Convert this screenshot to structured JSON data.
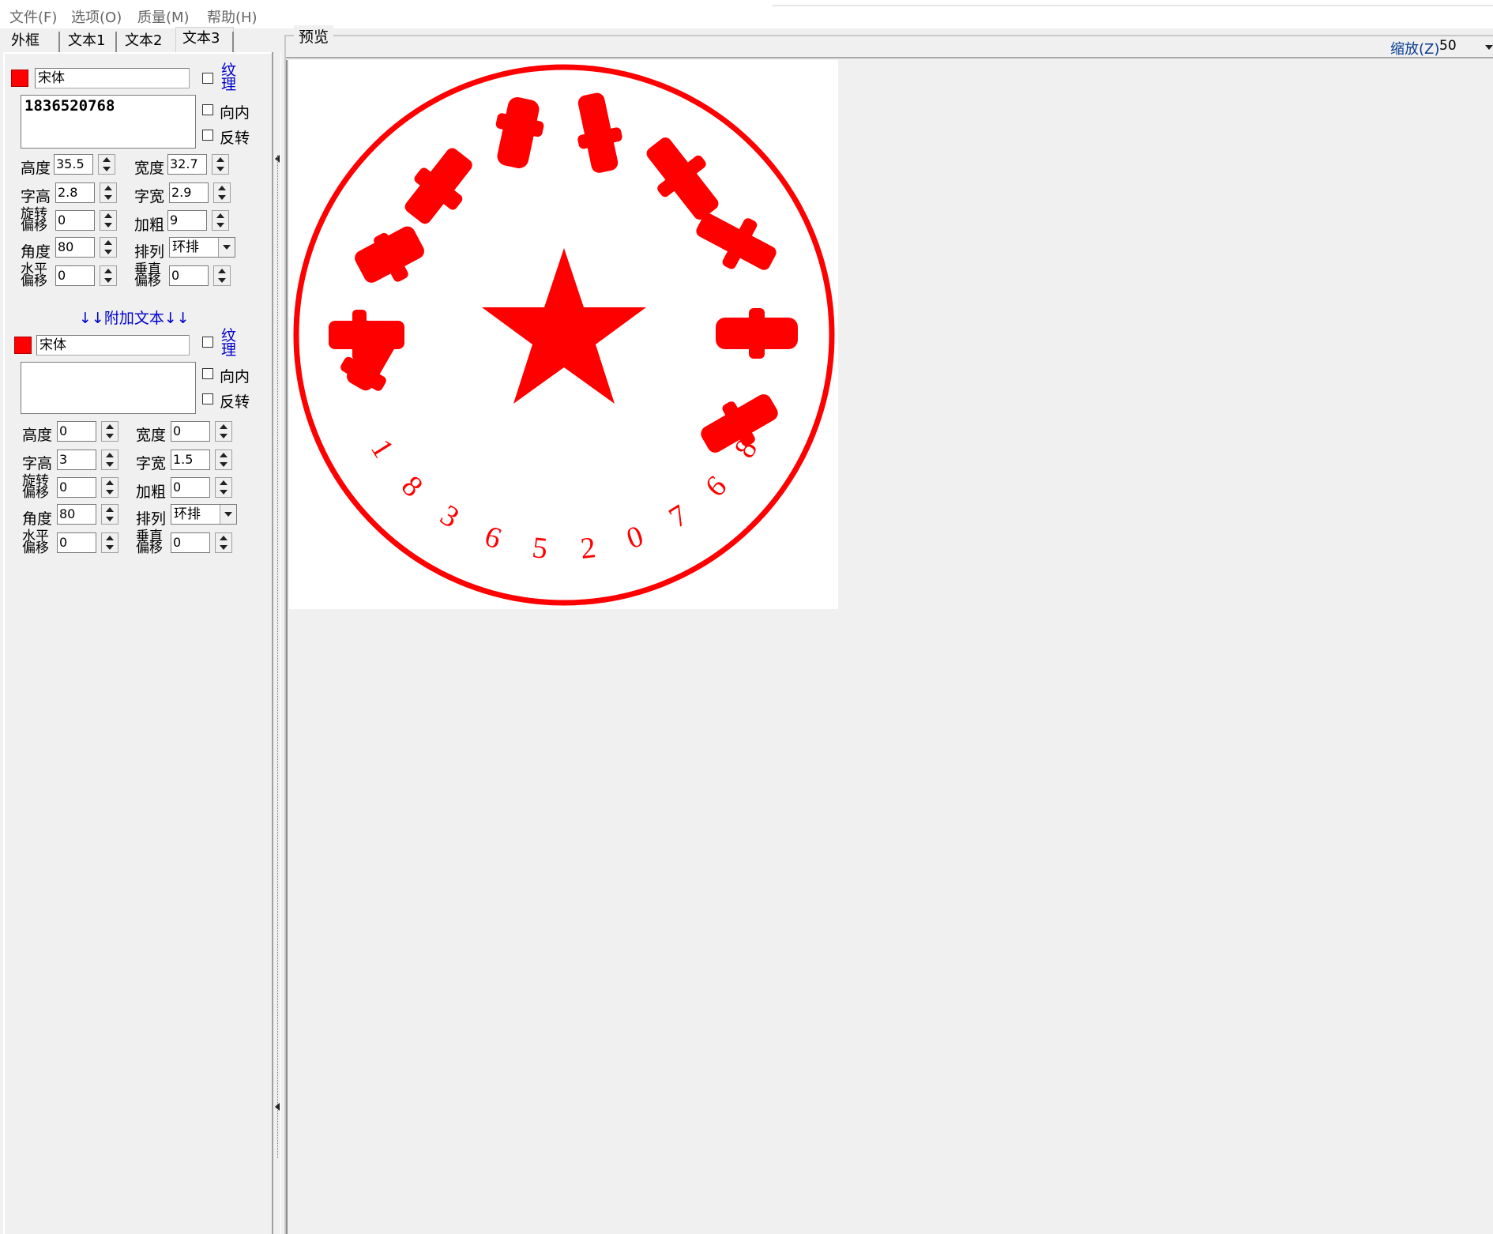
{
  "menu": {
    "file": "文件(F)",
    "options": "选项(O)",
    "quality": "质量(M)",
    "help": "帮助(H)"
  },
  "tabs": [
    "外框",
    "文本1",
    "文本2",
    "文本3"
  ],
  "active_tab": "文本3",
  "main_text": {
    "font": "宋体",
    "text": "1836520768",
    "texture_label_1": "纹",
    "texture_label_2": "理",
    "inward_label": "向内",
    "reverse_label": "反转",
    "height_label": "高度",
    "height": "35.5",
    "width_label": "宽度",
    "width": "32.7",
    "char_height_label": "字高",
    "char_height": "2.8",
    "char_width_label": "字宽",
    "char_width": "2.9",
    "rotate_offset_label_1": "旋转",
    "rotate_offset_label_2": "偏移",
    "rotate_offset": "0",
    "bold_label": "加粗",
    "bold": "9",
    "angle_label": "角度",
    "angle": "80",
    "arrange_label": "排列",
    "arrange": "环排",
    "h_offset_label_1": "水平",
    "h_offset_label_2": "偏移",
    "h_offset": "0",
    "v_offset_label_1": "垂直",
    "v_offset_label_2": "偏移",
    "v_offset": "0"
  },
  "extra_header": "↓↓附加文本↓↓",
  "extra_text": {
    "font": "宋体",
    "text": "",
    "texture_label_1": "纹",
    "texture_label_2": "理",
    "inward_label": "向内",
    "reverse_label": "反转",
    "height_label": "高度",
    "height": "0",
    "width_label": "宽度",
    "width": "0",
    "char_height_label": "字高",
    "char_height": "3",
    "char_width_label": "字宽",
    "char_width": "1.5",
    "rotate_offset_label_1": "旋转",
    "rotate_offset_label_2": "偏移",
    "rotate_offset": "0",
    "bold_label": "加粗",
    "bold": "0",
    "angle_label": "角度",
    "angle": "80",
    "arrange_label": "排列",
    "arrange": "环排",
    "h_offset_label_1": "水平",
    "h_offset_label_2": "偏移",
    "h_offset": "0",
    "v_offset_label_1": "垂直",
    "v_offset_label_2": "偏移",
    "v_offset": "0"
  },
  "preview": {
    "caption": "预览",
    "zoom_label": "缩放(Z)",
    "zoom_value": "50"
  },
  "stamp": {
    "color": "#ff0000",
    "bottom_digits": [
      "1",
      "8",
      "3",
      "6",
      "5",
      "2",
      "0",
      "7",
      "6",
      "8"
    ]
  }
}
